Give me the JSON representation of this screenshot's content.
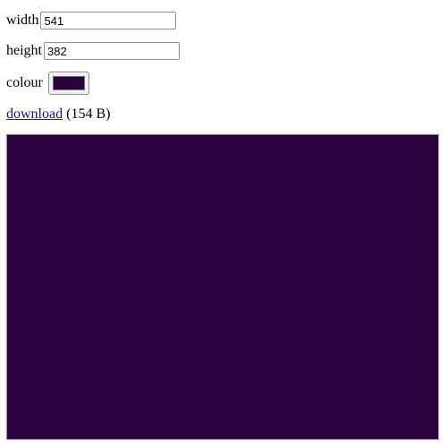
{
  "form": {
    "width_label": "width",
    "width_value": "541",
    "height_label": "height",
    "height_value": "382",
    "colour_label": "colour",
    "colour_value": "#2a003d"
  },
  "download": {
    "link_text": "download",
    "size_text": "(154 B)"
  },
  "preview": {
    "fill_color": "#2a003d"
  }
}
